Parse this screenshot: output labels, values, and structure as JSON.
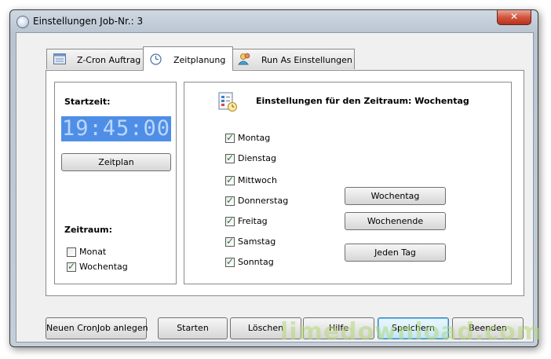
{
  "window": {
    "title": "Einstellungen Job-Nr.: 3",
    "close_symbol": "✕"
  },
  "tabs": [
    {
      "label": "Z-Cron Auftrag",
      "icon": "window-icon"
    },
    {
      "label": "Zeitplanung",
      "icon": "clock-icon",
      "active": true
    },
    {
      "label": "Run As Einstellungen",
      "icon": "users-icon"
    }
  ],
  "left_panel": {
    "startzeit_label": "Startzeit:",
    "time": "19:45:00",
    "zeitplan_button": "Zeitplan",
    "zeitraum_label": "Zeitraum:",
    "options": [
      {
        "label": "Monat",
        "checked": false
      },
      {
        "label": "Wochentag",
        "checked": true
      }
    ]
  },
  "right_panel": {
    "heading": "Einstellungen für den Zeitraum: Wochentag",
    "days": [
      {
        "label": "Montag",
        "checked": true
      },
      {
        "label": "Dienstag",
        "checked": true
      },
      {
        "label": "Mittwoch",
        "checked": true
      },
      {
        "label": "Donnerstag",
        "checked": true
      },
      {
        "label": "Freitag",
        "checked": true
      },
      {
        "label": "Samstag",
        "checked": true
      },
      {
        "label": "Sonntag",
        "checked": true
      }
    ],
    "buttons": {
      "wochentag": "Wochentag",
      "wochenende": "Wochenende",
      "jeden_tag": "Jeden Tag"
    }
  },
  "footer": {
    "neuen": "Neuen CronJob anlegen",
    "starten": "Starten",
    "loeschen": "Löschen",
    "hilfe": "Hilfe",
    "speichern": "Speichern",
    "beenden": "Beenden"
  },
  "watermark": "limedownload.com",
  "check_glyph": "✓"
}
